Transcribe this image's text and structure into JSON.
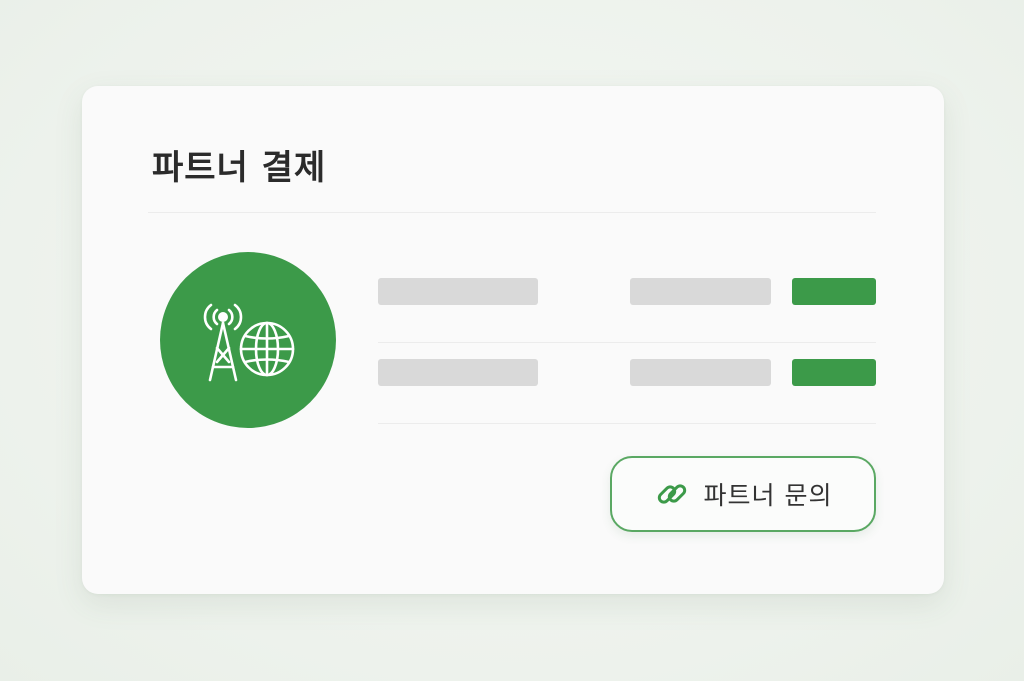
{
  "card": {
    "title": "파트너 결제"
  },
  "brand": {
    "icon": "antenna-globe-icon",
    "color": "#3c9a49"
  },
  "rows": [
    {
      "status_color": "#3c9a49"
    },
    {
      "status_color": "#3c9a49"
    }
  ],
  "actions": {
    "inquiry_label": "파트너 문의",
    "inquiry_icon": "link-icon",
    "border_color": "#5aa863"
  }
}
